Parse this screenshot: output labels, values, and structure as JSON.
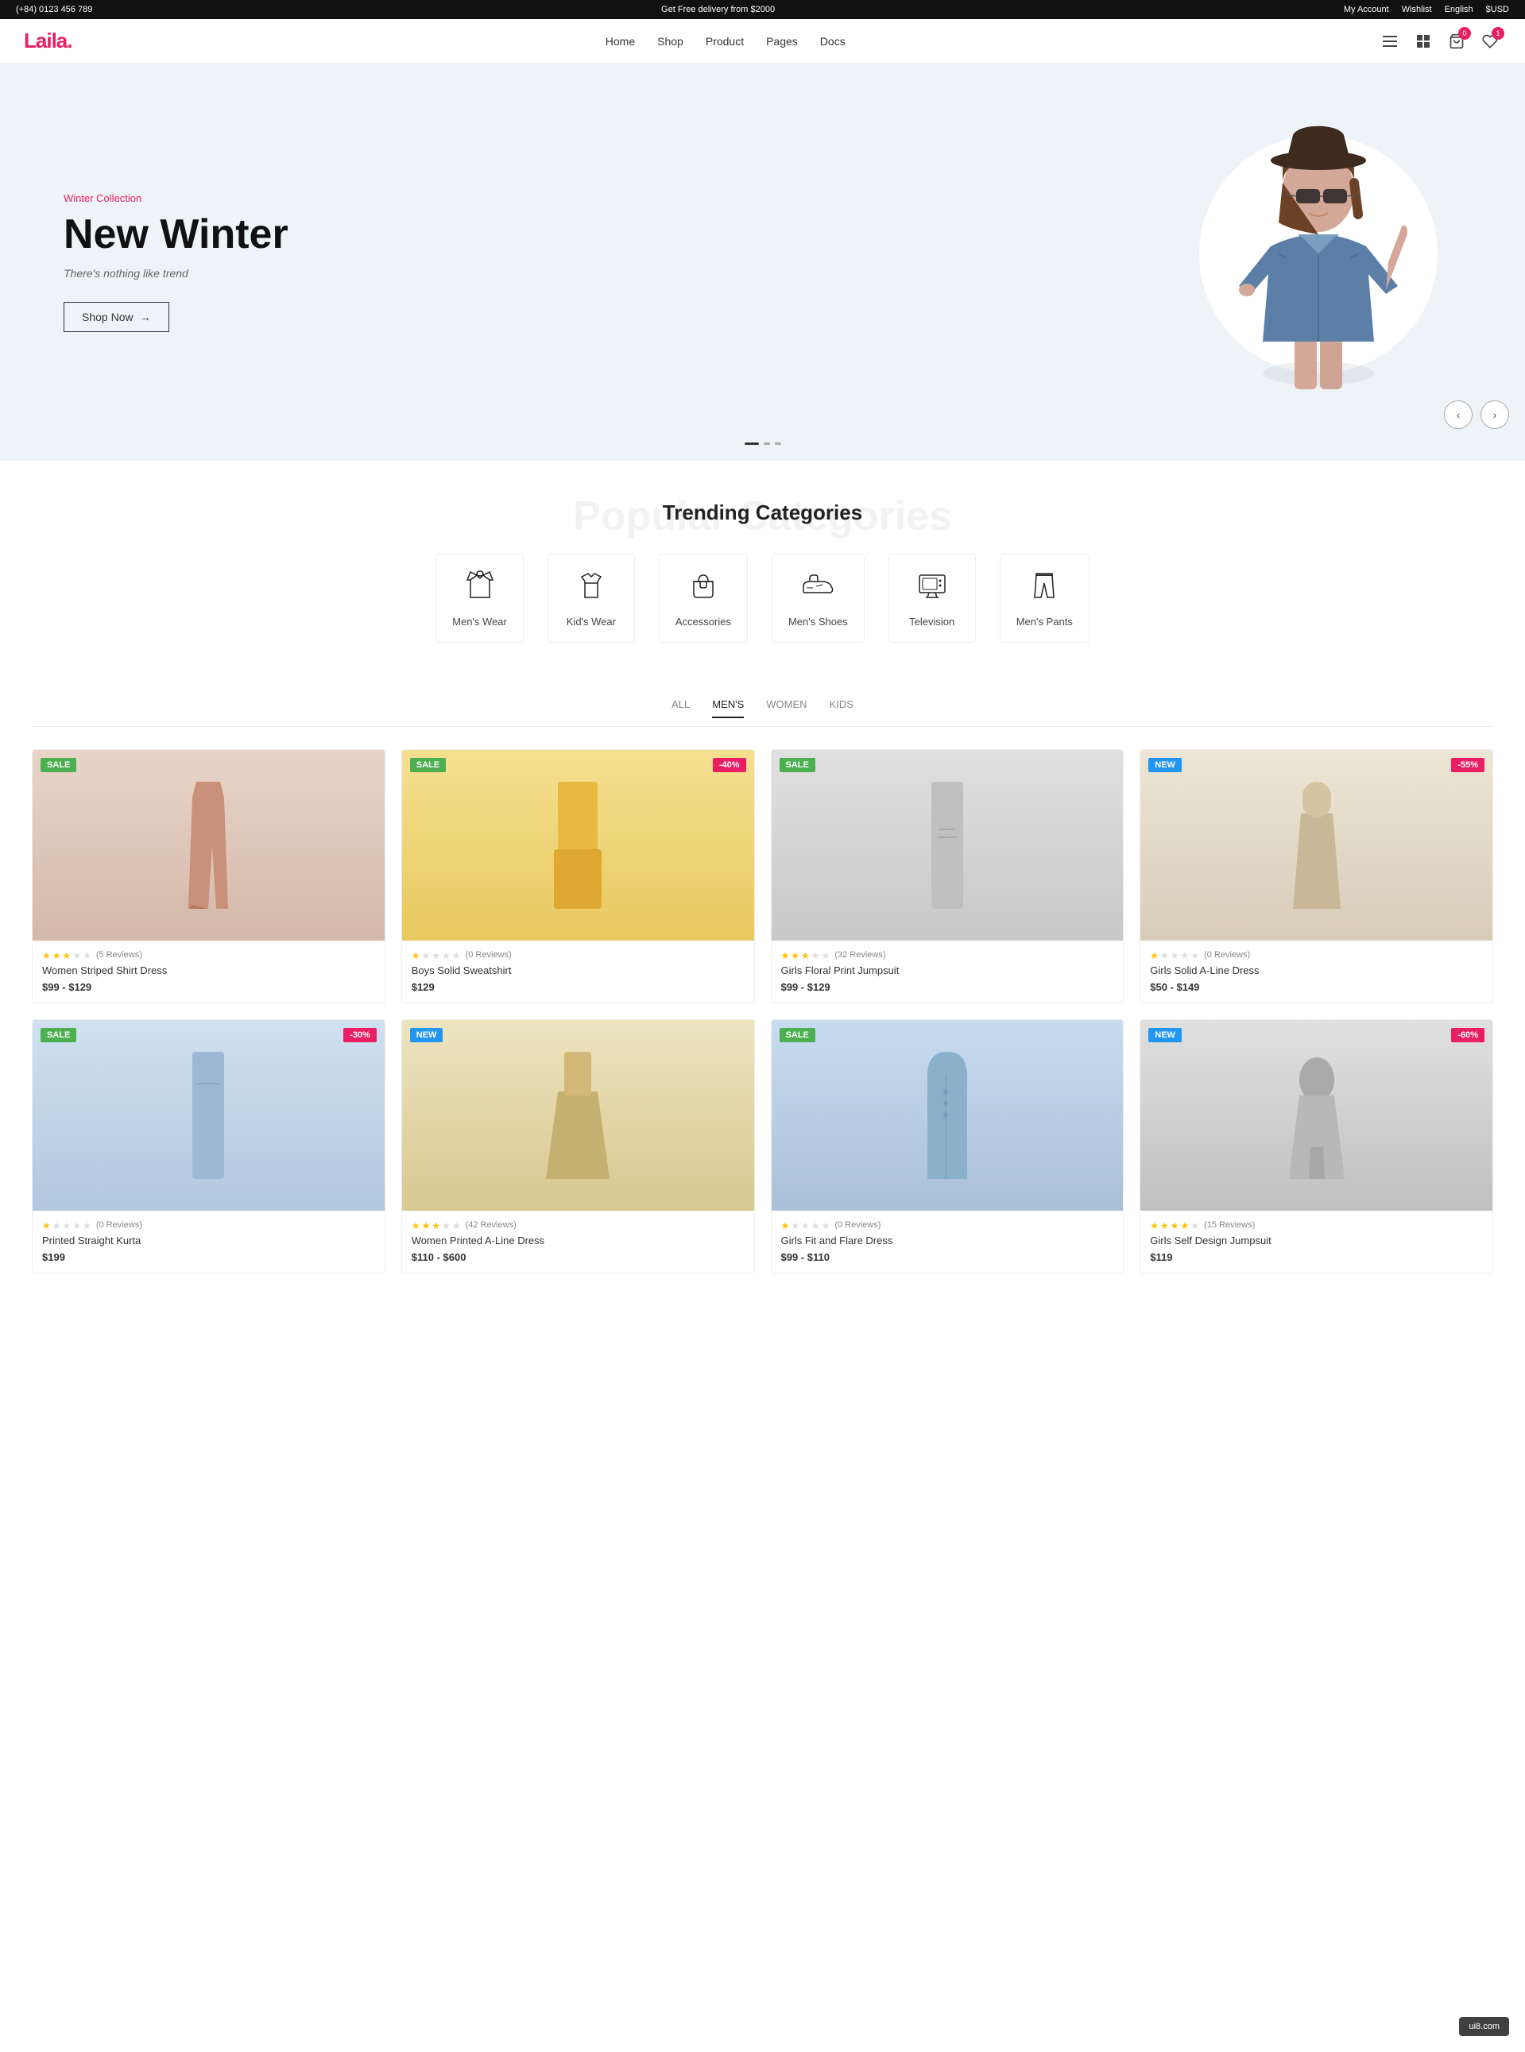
{
  "topbar": {
    "phone": "(+84) 0123 456 789",
    "promo": "Get Free delivery from $2000",
    "my_account": "My Account",
    "wishlist": "Wishlist",
    "language": "English",
    "currency": "$USD"
  },
  "header": {
    "logo": "Laila",
    "logo_dot": ".",
    "nav": [
      {
        "label": "Home",
        "href": "#"
      },
      {
        "label": "Shop",
        "href": "#"
      },
      {
        "label": "Product",
        "href": "#"
      },
      {
        "label": "Pages",
        "href": "#"
      },
      {
        "label": "Docs",
        "href": "#"
      }
    ],
    "cart_count": "0",
    "wishlist_count": "1"
  },
  "hero": {
    "subtitle": "Winter Collection",
    "title": "New Winter",
    "description": "There's nothing like trend",
    "cta": "Shop Now",
    "bg_color": "#eef3f7"
  },
  "categories_section": {
    "bg_text": "Popular Categories",
    "title": "Trending Categories",
    "items": [
      {
        "label": "Men's Wear",
        "icon": "dress"
      },
      {
        "label": "Kid's Wear",
        "icon": "tshirt"
      },
      {
        "label": "Accessories",
        "icon": "bag"
      },
      {
        "label": "Men's Shoes",
        "icon": "shoe"
      },
      {
        "label": "Television",
        "icon": "tv"
      },
      {
        "label": "Men's Pants",
        "icon": "pants"
      }
    ]
  },
  "products_section": {
    "tabs": [
      {
        "label": "ALL",
        "active": false
      },
      {
        "label": "MEN'S",
        "active": true
      },
      {
        "label": "WOMEN",
        "active": false
      },
      {
        "label": "KIDS",
        "active": false
      }
    ],
    "products": [
      {
        "badge_left": "SALE",
        "badge_left_type": "sale",
        "badge_right": null,
        "stars": 3,
        "reviews": "5 Reviews",
        "name": "Women Striped Shirt Dress",
        "price": "$99 - $129",
        "bg_color": "#e8d5c8"
      },
      {
        "badge_left": "SALE",
        "badge_left_type": "sale",
        "badge_right": "-40%",
        "stars": 1,
        "reviews": "0 Reviews",
        "name": "Boys Solid Sweatshirt",
        "price": "$129",
        "bg_color": "#f5d58a"
      },
      {
        "badge_left": "SALE",
        "badge_left_type": "sale",
        "badge_right": null,
        "stars": 3,
        "reviews": "32 Reviews",
        "name": "Girls Floral Print Jumpsuit",
        "price": "$99 - $129",
        "bg_color": "#d9d9d9"
      },
      {
        "badge_left": "NEW",
        "badge_left_type": "new",
        "badge_right": "-55%",
        "stars": 1,
        "reviews": "0 Reviews",
        "name": "Girls Solid A-Line Dress",
        "price": "$50 - $149",
        "bg_color": "#e8e0d0"
      },
      {
        "badge_left": "SALE",
        "badge_left_type": "sale",
        "badge_right": "-30%",
        "stars": 1,
        "reviews": "0 Reviews",
        "name": "Printed Straight Kurta",
        "price": "$199",
        "bg_color": "#c8d8e8"
      },
      {
        "badge_left": "NEW",
        "badge_left_type": "new",
        "badge_right": null,
        "stars": 3,
        "reviews": "42 Reviews",
        "name": "Women Printed A-Line Dress",
        "price": "$110 - $600",
        "bg_color": "#d4c890"
      },
      {
        "badge_left": "SALE",
        "badge_left_type": "sale",
        "badge_right": null,
        "stars": 1,
        "reviews": "0 Reviews",
        "name": "Girls Fit and Flare Dress",
        "price": "$99 - $110",
        "bg_color": "#b8cce0"
      },
      {
        "badge_left": "NEW",
        "badge_left_type": "new",
        "badge_right": "-60%",
        "stars": 4,
        "reviews": "15 Reviews",
        "name": "Girls Self Design Jumpsuit",
        "price": "$119",
        "bg_color": "#d8d8d8"
      }
    ]
  },
  "footer": {
    "watermark": "ui8.com"
  }
}
